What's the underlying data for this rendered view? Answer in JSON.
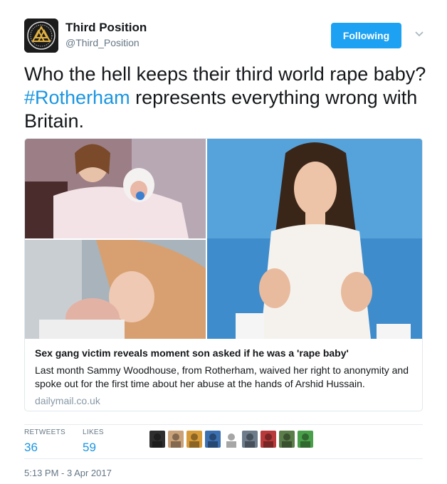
{
  "author": {
    "name": "Third Position",
    "handle": "@Third_Position",
    "avatar_icon": "valknut-logo-icon"
  },
  "follow_button": {
    "label": "Following",
    "color": "#1da1f2"
  },
  "tweet": {
    "text_before": "Who the hell keeps their third world rape baby? ",
    "hashtag": "#Rotherham",
    "text_after": " represents everything wrong with Britain."
  },
  "card": {
    "images": [
      "mother-holding-newborn-photo",
      "mother-with-baby-in-hospital-photo",
      "woman-talking-on-tv-photo"
    ],
    "title": "Sex gang victim reveals moment son asked if he was a 'rape baby'",
    "description": "Last month Sammy Woodhouse, from Rotherham, waived her right to anonymity and spoke out for the first time about her abuse at the hands of Arshid Hussain.",
    "domain": "dailymail.co.uk"
  },
  "stats": {
    "retweets_label": "RETWEETS",
    "retweets_value": "36",
    "likes_label": "LIKES",
    "likes_value": "59"
  },
  "likers": [
    "#2e2e2e",
    "#c9a27a",
    "#d89b3a",
    "#3b6fb0",
    "#ffffff",
    "#6d7b8a",
    "#b83a3a",
    "#5a7d4a",
    "#4aa04a"
  ],
  "timestamp": "5:13 PM - 3 Apr 2017",
  "colors": {
    "link": "#1b95e0",
    "secondary": "#657786",
    "border": "#e1e8ed"
  }
}
